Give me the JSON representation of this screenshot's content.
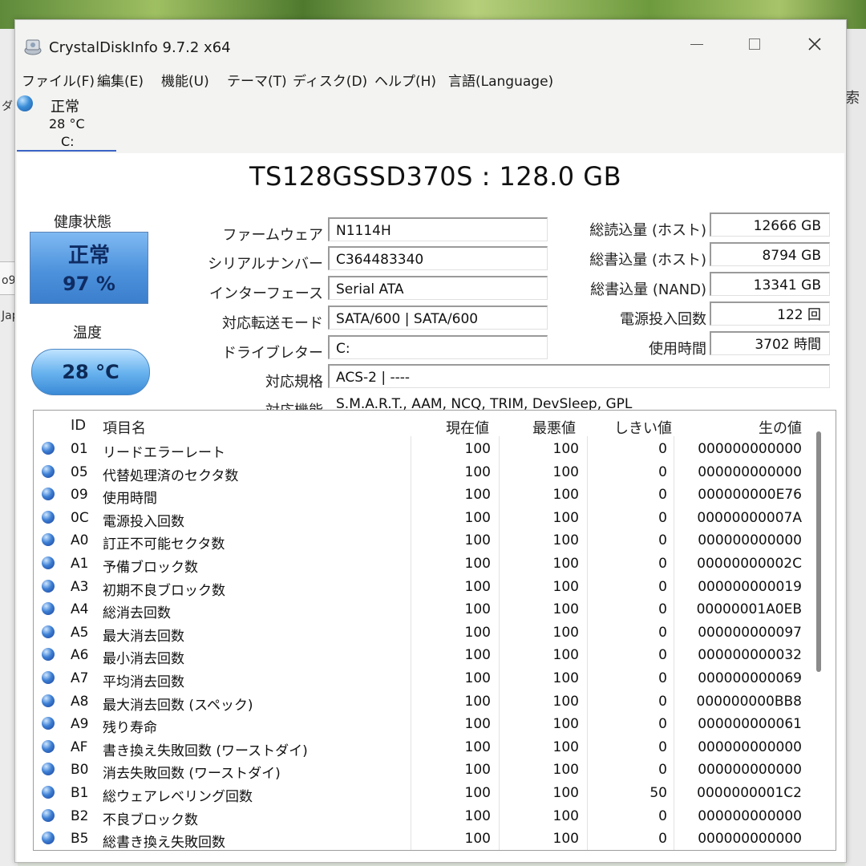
{
  "background": {
    "left_fragments": [
      "ダ",
      "o9_",
      "Jap"
    ],
    "right_fragment": "索"
  },
  "window": {
    "title": "CrystalDiskInfo 9.7.2 x64",
    "menu": [
      "ファイル(F)",
      "編集(E)",
      "機能(U)",
      "テーマ(T)",
      "ディスク(D)",
      "ヘルプ(H)",
      "言語(Language)"
    ]
  },
  "disk_tab": {
    "status": "正常",
    "temp": "28 °C",
    "drive": "C:"
  },
  "model": "TS128GSSD370S : 128.0 GB",
  "health": {
    "label": "健康状態",
    "status": "正常",
    "percent": "97 %",
    "color": "#4d92dc"
  },
  "temperature": {
    "label": "温度",
    "value": "28 °C"
  },
  "info_left": [
    {
      "label": "ファームウェア",
      "value": "N1114H"
    },
    {
      "label": "シリアルナンバー",
      "value": "C364483340"
    },
    {
      "label": "インターフェース",
      "value": "Serial ATA"
    },
    {
      "label": "対応転送モード",
      "value": "SATA/600 | SATA/600"
    },
    {
      "label": "ドライブレター",
      "value": "C:"
    },
    {
      "label": "対応規格",
      "value": "ACS-2 | ----"
    },
    {
      "label": "対応機能",
      "value": "S.M.A.R.T., AAM, NCQ, TRIM, DevSleep, GPL"
    }
  ],
  "info_right": [
    {
      "label": "総読込量 (ホスト)",
      "value": "12666 GB"
    },
    {
      "label": "総書込量 (ホスト)",
      "value": "8794 GB"
    },
    {
      "label": "総書込量 (NAND)",
      "value": "13341 GB"
    },
    {
      "label": "電源投入回数",
      "value": "122 回"
    },
    {
      "label": "使用時間",
      "value": "3702 時間"
    }
  ],
  "smart": {
    "headers": [
      "ID",
      "項目名",
      "現在値",
      "最悪値",
      "しきい値",
      "生の値"
    ],
    "rows": [
      {
        "id": "01",
        "name": "リードエラーレート",
        "cur": "100",
        "worst": "100",
        "thr": "0",
        "raw": "000000000000"
      },
      {
        "id": "05",
        "name": "代替処理済のセクタ数",
        "cur": "100",
        "worst": "100",
        "thr": "0",
        "raw": "000000000000"
      },
      {
        "id": "09",
        "name": "使用時間",
        "cur": "100",
        "worst": "100",
        "thr": "0",
        "raw": "000000000E76"
      },
      {
        "id": "0C",
        "name": "電源投入回数",
        "cur": "100",
        "worst": "100",
        "thr": "0",
        "raw": "00000000007A"
      },
      {
        "id": "A0",
        "name": "訂正不可能セクタ数",
        "cur": "100",
        "worst": "100",
        "thr": "0",
        "raw": "000000000000"
      },
      {
        "id": "A1",
        "name": "予備ブロック数",
        "cur": "100",
        "worst": "100",
        "thr": "0",
        "raw": "00000000002C"
      },
      {
        "id": "A3",
        "name": "初期不良ブロック数",
        "cur": "100",
        "worst": "100",
        "thr": "0",
        "raw": "000000000019"
      },
      {
        "id": "A4",
        "name": "総消去回数",
        "cur": "100",
        "worst": "100",
        "thr": "0",
        "raw": "00000001A0EB"
      },
      {
        "id": "A5",
        "name": "最大消去回数",
        "cur": "100",
        "worst": "100",
        "thr": "0",
        "raw": "000000000097"
      },
      {
        "id": "A6",
        "name": "最小消去回数",
        "cur": "100",
        "worst": "100",
        "thr": "0",
        "raw": "000000000032"
      },
      {
        "id": "A7",
        "name": "平均消去回数",
        "cur": "100",
        "worst": "100",
        "thr": "0",
        "raw": "000000000069"
      },
      {
        "id": "A8",
        "name": "最大消去回数 (スペック)",
        "cur": "100",
        "worst": "100",
        "thr": "0",
        "raw": "000000000BB8"
      },
      {
        "id": "A9",
        "name": "残り寿命",
        "cur": "100",
        "worst": "100",
        "thr": "0",
        "raw": "000000000061"
      },
      {
        "id": "AF",
        "name": "書き換え失敗回数 (ワーストダイ)",
        "cur": "100",
        "worst": "100",
        "thr": "0",
        "raw": "000000000000"
      },
      {
        "id": "B0",
        "name": "消去失敗回数 (ワーストダイ)",
        "cur": "100",
        "worst": "100",
        "thr": "0",
        "raw": "000000000000"
      },
      {
        "id": "B1",
        "name": "総ウェアレベリング回数",
        "cur": "100",
        "worst": "100",
        "thr": "50",
        "raw": "0000000001C2"
      },
      {
        "id": "B2",
        "name": "不良ブロック数",
        "cur": "100",
        "worst": "100",
        "thr": "0",
        "raw": "000000000000"
      },
      {
        "id": "B5",
        "name": "総書き換え失敗回数",
        "cur": "100",
        "worst": "100",
        "thr": "0",
        "raw": "000000000000"
      }
    ]
  }
}
